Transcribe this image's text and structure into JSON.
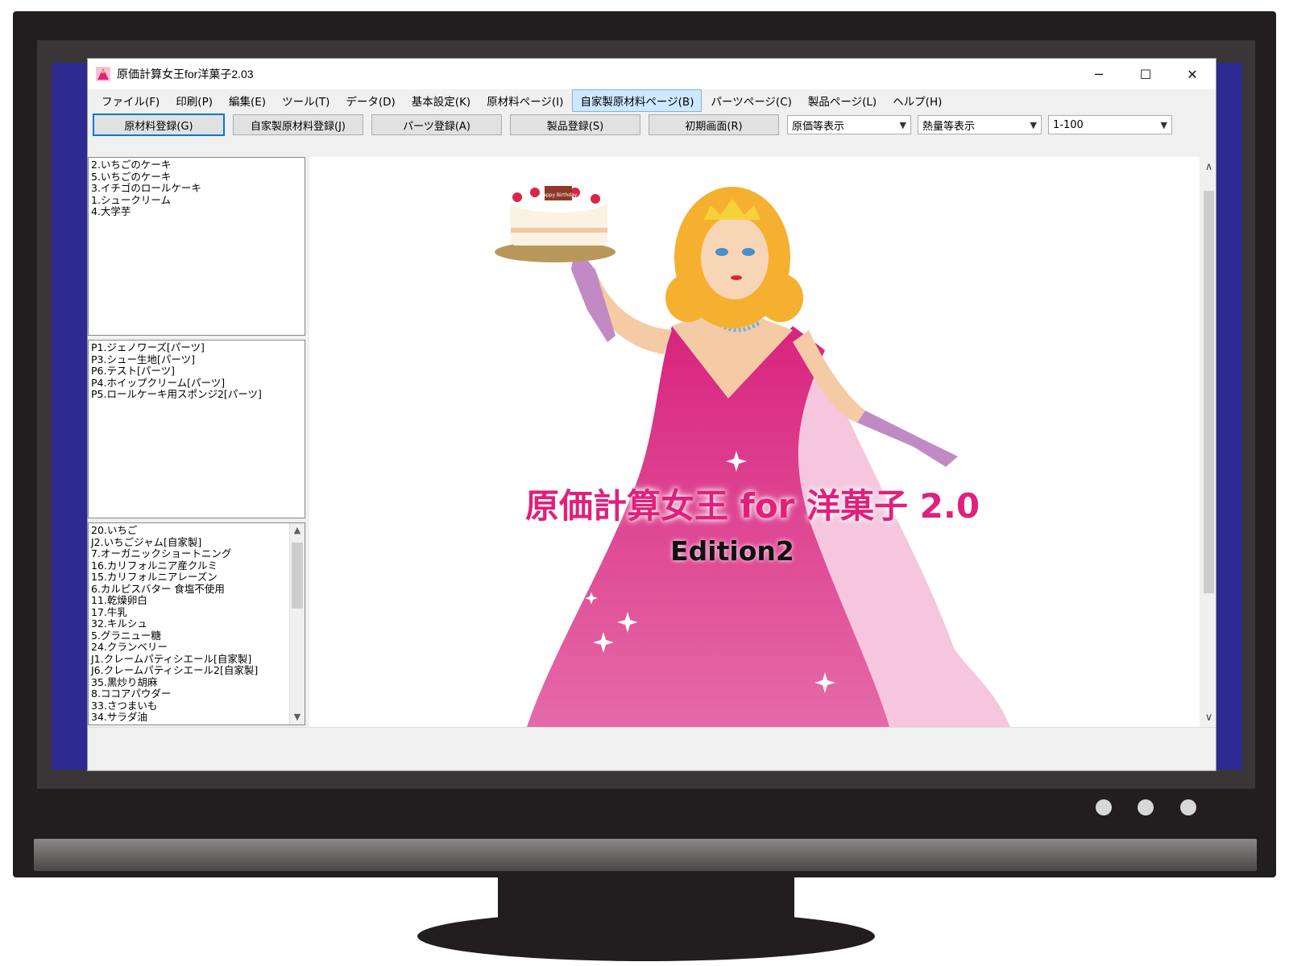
{
  "window": {
    "title": "原価計算女王for洋菓子2.03",
    "controls": {
      "minimize": "─",
      "maximize": "☐",
      "close": "✕"
    }
  },
  "menu": {
    "items": [
      "ファイル(F)",
      "印刷(P)",
      "編集(E)",
      "ツール(T)",
      "データ(D)",
      "基本設定(K)",
      "原材料ページ(I)",
      "自家製原材料ページ(B)",
      "パーツページ(C)",
      "製品ページ(L)",
      "ヘルプ(H)"
    ],
    "active_index": 7
  },
  "toolbar": {
    "buttons": [
      "原材料登録(G)",
      "自家製原材料登録(J)",
      "パーツ登録(A)",
      "製品登録(S)",
      "初期画面(R)"
    ],
    "selects": [
      "原価等表示",
      "熱量等表示",
      "1-100"
    ]
  },
  "lists": {
    "products": [
      "2.いちごのケーキ",
      "5.いちごのケーキ",
      "3.イチゴのロールケーキ",
      "1.シュークリーム",
      "4.大学芋"
    ],
    "parts": [
      "P1.ジェノワーズ[パーツ]",
      "P3.シュー生地[パーツ]",
      "P6.テスト[パーツ]",
      "P4.ホイップクリーム[パーツ]",
      "P5.ロールケーキ用スポンジ2[パーツ]"
    ],
    "ingredients": [
      "20.いちご",
      "J2.いちごジャム[自家製]",
      "7.オーガニックショートニング",
      "16.カリフォルニア産クルミ",
      "15.カリフォルニアレーズン",
      "6.カルピスバター 食塩不使用",
      "11.乾燥卵白",
      "17.牛乳",
      "32.キルシュ",
      "5.グラニュー糖",
      "24.クランベリー",
      "J1.クレームパティシエール[自家製]",
      "J6.クレームパティシエール2[自家製]",
      "35.黒炒り胡麻",
      "8.ココアパウダー",
      "33.さつまいも",
      "34.サラダ油"
    ]
  },
  "splash": {
    "title": "原価計算女王 for 洋菓子 2.0",
    "edition": "Edition2",
    "cake_text": "Happy Birthday"
  },
  "colors": {
    "accent_pink": "#e0207a",
    "desktop_blue": "#2d2a92",
    "dress_pink": "#e04e98",
    "hair_gold": "#f5b030"
  },
  "icons": {
    "app": "queen-app-icon",
    "scroll_up": "chevron-up-icon",
    "scroll_down": "chevron-down-icon",
    "dropdown": "chevron-down-icon"
  }
}
